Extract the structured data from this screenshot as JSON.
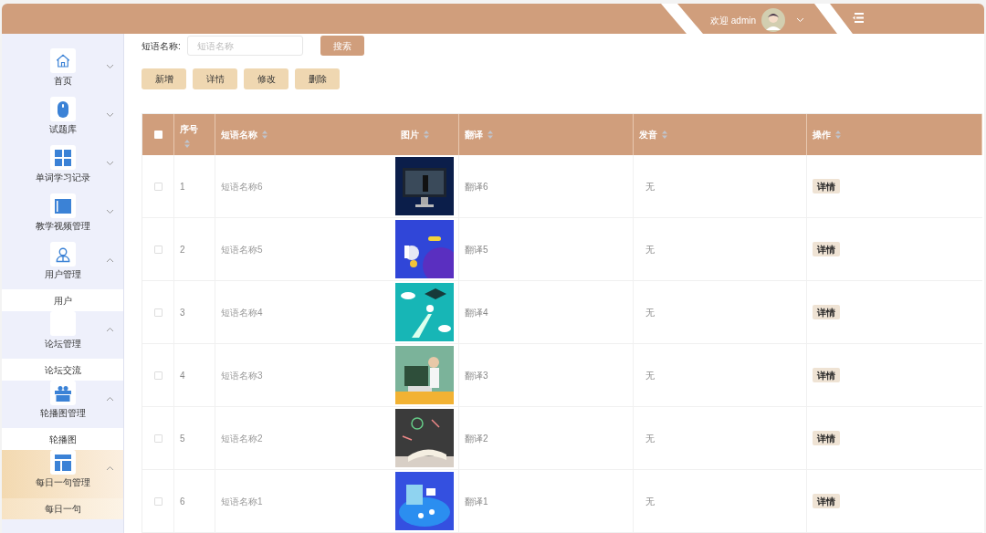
{
  "header": {
    "welcome": "欢迎 admin"
  },
  "sidebar": {
    "items": [
      {
        "label": "首页",
        "expanded": false,
        "selected": false
      },
      {
        "label": "试题库",
        "expanded": false,
        "selected": false
      },
      {
        "label": "单词学习记录",
        "expanded": false,
        "selected": false
      },
      {
        "label": "教学视频管理",
        "expanded": false,
        "selected": false
      },
      {
        "label": "用户管理",
        "expanded": true,
        "selected": false,
        "children": [
          {
            "label": "用户",
            "selected": false
          }
        ]
      },
      {
        "label": "论坛管理",
        "expanded": true,
        "selected": false,
        "children": [
          {
            "label": "论坛交流",
            "selected": false
          }
        ]
      },
      {
        "label": "轮播图管理",
        "expanded": true,
        "selected": false,
        "children": [
          {
            "label": "轮播图",
            "selected": false
          }
        ]
      },
      {
        "label": "每日一句管理",
        "expanded": true,
        "selected": true,
        "children": [
          {
            "label": "每日一句",
            "selected": true
          }
        ]
      }
    ]
  },
  "search": {
    "label": "短语名称:",
    "placeholder": "短语名称",
    "button": "搜索"
  },
  "toolbar": [
    "新增",
    "详情",
    "修改",
    "删除"
  ],
  "table": {
    "select_all_checked": false,
    "columns": [
      "序号",
      "短语名称",
      "图片",
      "翻译",
      "发音",
      "操作"
    ],
    "rows": [
      {
        "checked": false,
        "index": "1",
        "name": "短语名称6",
        "translation": "翻译6",
        "pronunciation": "无",
        "action": "详情"
      },
      {
        "checked": false,
        "index": "2",
        "name": "短语名称5",
        "translation": "翻译5",
        "pronunciation": "无",
        "action": "详情"
      },
      {
        "checked": false,
        "index": "3",
        "name": "短语名称4",
        "translation": "翻译4",
        "pronunciation": "无",
        "action": "详情"
      },
      {
        "checked": false,
        "index": "4",
        "name": "短语名称3",
        "translation": "翻译3",
        "pronunciation": "无",
        "action": "详情"
      },
      {
        "checked": false,
        "index": "5",
        "name": "短语名称2",
        "translation": "翻译2",
        "pronunciation": "无",
        "action": "详情"
      },
      {
        "checked": false,
        "index": "6",
        "name": "短语名称1",
        "translation": "翻译1",
        "pronunciation": "无",
        "action": "详情"
      }
    ]
  }
}
